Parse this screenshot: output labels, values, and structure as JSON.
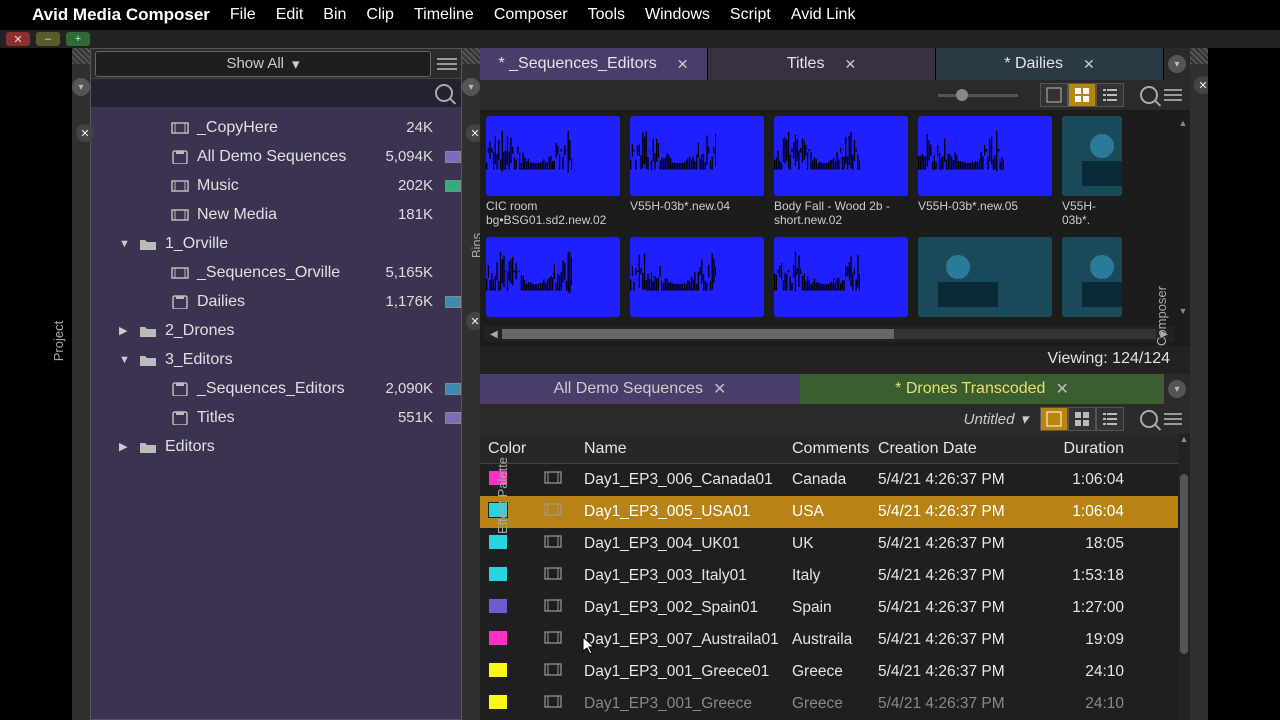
{
  "menubar": {
    "app": "Avid Media Composer",
    "items": [
      "File",
      "Edit",
      "Bin",
      "Clip",
      "Timeline",
      "Composer",
      "Tools",
      "Windows",
      "Script",
      "Avid Link"
    ]
  },
  "sidebars": {
    "project": "Project",
    "bins": "Bins",
    "effect": "Effect Palette",
    "composer": "Composer"
  },
  "project": {
    "filter": "Show All",
    "tree": [
      {
        "icon": "clip",
        "name": "_CopyHere",
        "size": "24K",
        "swatch": null,
        "indent": 2,
        "disclose": ""
      },
      {
        "icon": "bin",
        "name": "All Demo Sequences",
        "size": "5,094K",
        "swatch": "#7d6bbb",
        "indent": 2,
        "disclose": ""
      },
      {
        "icon": "clip",
        "name": "Music",
        "size": "202K",
        "swatch": "#2fae7a",
        "indent": 2,
        "disclose": ""
      },
      {
        "icon": "clip",
        "name": "New Media",
        "size": "181K",
        "swatch": null,
        "indent": 2,
        "disclose": ""
      },
      {
        "icon": "folder",
        "name": "1_Orville",
        "size": "",
        "swatch": null,
        "indent": 1,
        "disclose": "▼"
      },
      {
        "icon": "clip",
        "name": "_Sequences_Orville",
        "size": "5,165K",
        "swatch": null,
        "indent": 2,
        "disclose": ""
      },
      {
        "icon": "bin",
        "name": "Dailies",
        "size": "1,176K",
        "swatch": "#3d88b5",
        "indent": 2,
        "disclose": ""
      },
      {
        "icon": "folder",
        "name": "2_Drones",
        "size": "",
        "swatch": null,
        "indent": 1,
        "disclose": "▶"
      },
      {
        "icon": "folder",
        "name": "3_Editors",
        "size": "",
        "swatch": null,
        "indent": 1,
        "disclose": "▼"
      },
      {
        "icon": "bin",
        "name": "_Sequences_Editors",
        "size": "2,090K",
        "swatch": "#3d88b5",
        "indent": 2,
        "disclose": ""
      },
      {
        "icon": "bin",
        "name": "Titles",
        "size": "551K",
        "swatch": "#7d6bbb",
        "indent": 2,
        "disclose": ""
      },
      {
        "icon": "folder",
        "name": "Editors",
        "size": "",
        "swatch": null,
        "indent": 1,
        "disclose": "▶"
      }
    ]
  },
  "topTabs": [
    {
      "label": "* _Sequences_Editors",
      "cls": "seq"
    },
    {
      "label": "Titles",
      "cls": "titles"
    },
    {
      "label": "* Dailies",
      "cls": "dail"
    }
  ],
  "thumbs": {
    "row1": [
      {
        "label": "CIC room bg•BSG01.sd2.new.02",
        "kind": "wave"
      },
      {
        "label": "V55H-03b*.new.04",
        "kind": "wave"
      },
      {
        "label": "Body Fall - Wood 2b - short.new.02",
        "kind": "wave"
      },
      {
        "label": "V55H-03b*.new.05",
        "kind": "wave"
      },
      {
        "label": "V55H-03b*.",
        "kind": "video-crop"
      }
    ],
    "row2": [
      {
        "label": "",
        "kind": "wave"
      },
      {
        "label": "",
        "kind": "wave"
      },
      {
        "label": "",
        "kind": "wave"
      },
      {
        "label": "",
        "kind": "video"
      },
      {
        "label": "",
        "kind": "video-crop"
      }
    ],
    "viewing": "Viewing: 124/124"
  },
  "bottomTabs": {
    "demo": "All Demo Sequences",
    "drones": "* Drones Transcoded",
    "untitled": "Untitled"
  },
  "table": {
    "headers": {
      "color": "Color",
      "name": "Name",
      "comments": "Comments",
      "date": "Creation Date",
      "duration": "Duration"
    },
    "rows": [
      {
        "color": "#ff2fc3",
        "name": "Day1_EP3_006_Canada01",
        "comments": "Canada",
        "date": "5/4/21 4:26:37 PM",
        "duration": "1:06:04",
        "sel": false
      },
      {
        "color": "#29d4de",
        "name": "Day1_EP3_005_USA01",
        "comments": "USA",
        "date": "5/4/21 4:26:37 PM",
        "duration": "1:06:04",
        "sel": true
      },
      {
        "color": "#29d4de",
        "name": "Day1_EP3_004_UK01",
        "comments": "UK",
        "date": "5/4/21 4:26:37 PM",
        "duration": "18:05",
        "sel": false
      },
      {
        "color": "#29d4de",
        "name": "Day1_EP3_003_Italy01",
        "comments": "Italy",
        "date": "5/4/21 4:26:37 PM",
        "duration": "1:53:18",
        "sel": false
      },
      {
        "color": "#6b5dd0",
        "name": "Day1_EP3_002_Spain01",
        "comments": "Spain",
        "date": "5/4/21 4:26:37 PM",
        "duration": "1:27:00",
        "sel": false
      },
      {
        "color": "#ff2fc3",
        "name": "Day1_EP3_007_Austraila01",
        "comments": "Austraila",
        "date": "5/4/21 4:26:37 PM",
        "duration": "19:09",
        "sel": false
      },
      {
        "color": "#f8f81a",
        "name": "Day1_EP3_001_Greece01",
        "comments": "Greece",
        "date": "5/4/21 4:26:37 PM",
        "duration": "24:10",
        "sel": false
      },
      {
        "color": "#f8f81a",
        "name": "Day1_EP3_001_Greece",
        "comments": "Greece",
        "date": "5/4/21 4:26:37 PM",
        "duration": "24:10",
        "sel": false,
        "dim": true
      }
    ]
  }
}
